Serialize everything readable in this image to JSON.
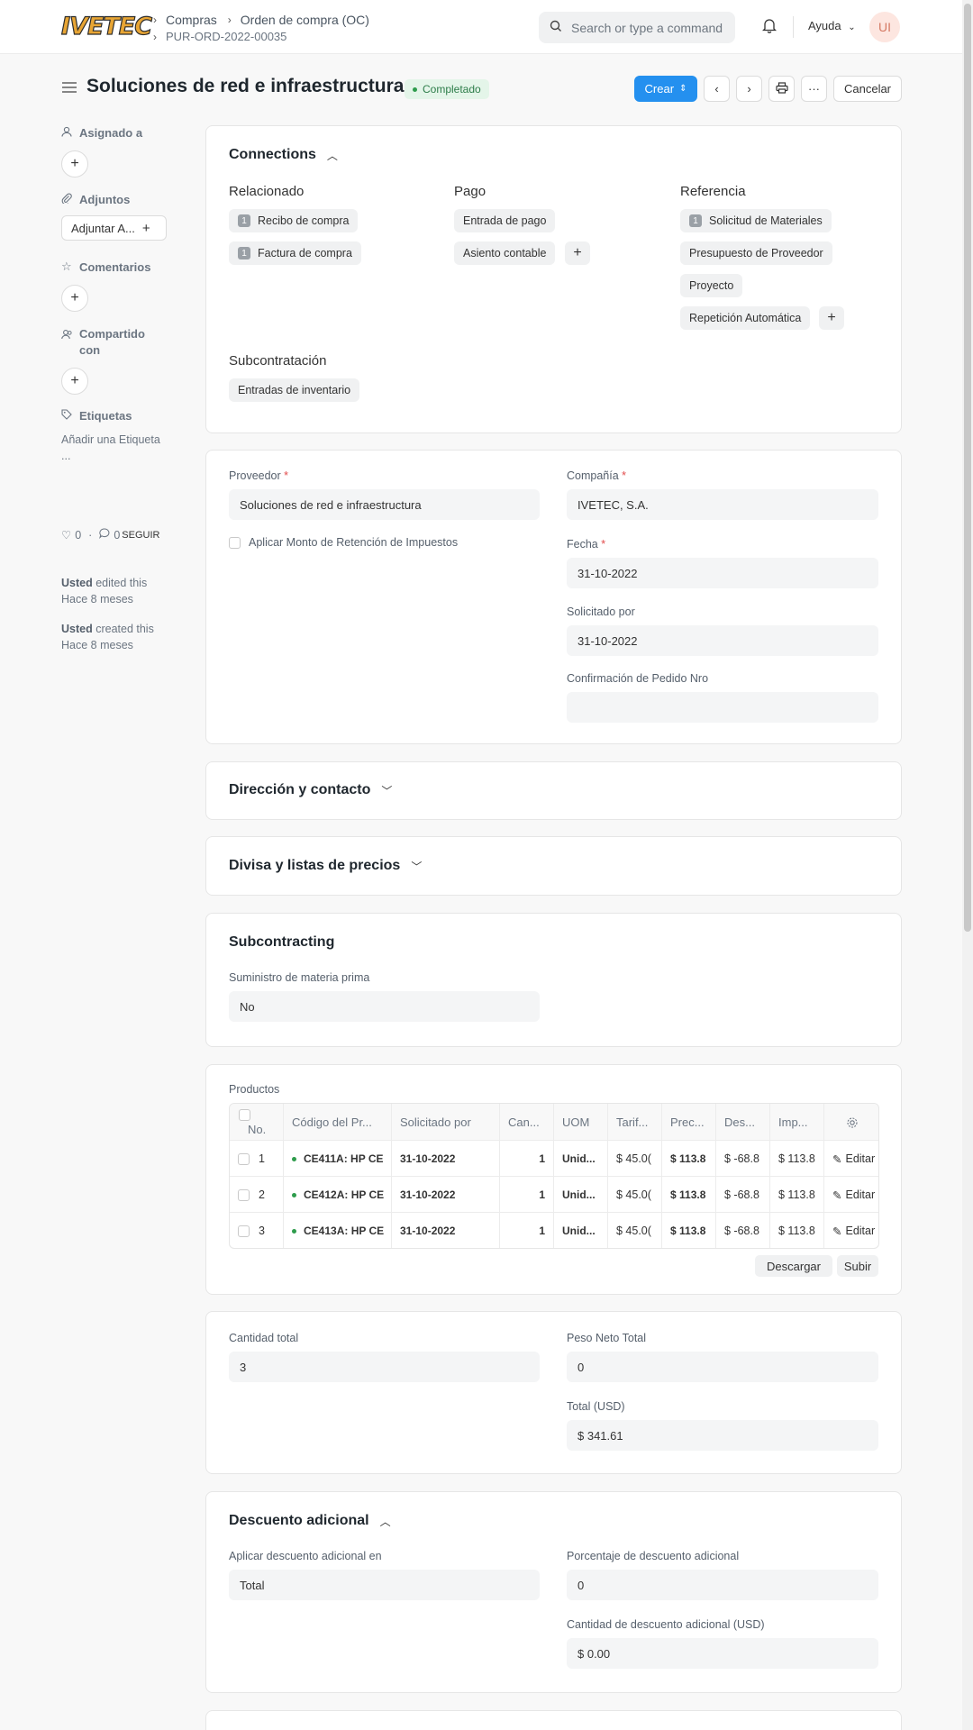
{
  "topbar": {
    "logo_text": "IVETEC",
    "breadcrumbs": [
      "Compras",
      "Orden de compra (OC)"
    ],
    "doc_id": "PUR-ORD-2022-00035",
    "search_placeholder": "Search or type a command",
    "help_label": "Ayuda",
    "avatar_initials": "UI"
  },
  "header": {
    "title": "Soluciones de red e infraestructura",
    "status": "Completado",
    "create_label": "Crear",
    "more_label": "···",
    "cancel_label": "Cancelar"
  },
  "sidebar": {
    "assigned_label": "Asignado a",
    "attachments_label": "Adjuntos",
    "attach_button": "Adjuntar A...",
    "comments_label": "Comentarios",
    "shared_label": "Compartido con",
    "tags_label": "Etiquetas",
    "add_tag": "Añadir una Etiqueta ...",
    "likes": "0",
    "comments_count": "0",
    "follow_label": "SEGUIR",
    "activity": [
      {
        "who": "Usted",
        "action": "edited this",
        "when": "Hace 8 meses"
      },
      {
        "who": "Usted",
        "action": "created this",
        "when": "Hace 8 meses"
      }
    ]
  },
  "connections": {
    "title": "Connections",
    "groups": [
      {
        "heading": "Relacionado",
        "items": [
          {
            "count": "1",
            "label": "Recibo de compra"
          },
          {
            "count": "1",
            "label": "Factura de compra"
          }
        ]
      },
      {
        "heading": "Pago",
        "items": [
          {
            "count": "",
            "label": "Entrada de pago"
          },
          {
            "count": "",
            "label": "Asiento contable"
          }
        ]
      },
      {
        "heading": "Referencia",
        "items": [
          {
            "count": "1",
            "label": "Solicitud de Materiales"
          },
          {
            "count": "",
            "label": "Presupuesto de Proveedor"
          },
          {
            "count": "",
            "label": "Proyecto"
          },
          {
            "count": "",
            "label": "Repetición Automática"
          }
        ]
      },
      {
        "heading": "Subcontratación",
        "items": [
          {
            "count": "",
            "label": "Entradas de inventario"
          }
        ]
      }
    ]
  },
  "details": {
    "supplier_label": "Proveedor",
    "supplier_value": "Soluciones de red e infraestructura",
    "withholding_label": "Aplicar Monto de Retención de Impuestos",
    "company_label": "Compañía",
    "company_value": "IVETEC, S.A.",
    "date_label": "Fecha",
    "date_value": "31-10-2022",
    "required_by_label": "Solicitado por",
    "required_by_value": "31-10-2022",
    "order_confirmation_label": "Confirmación de Pedido Nro",
    "order_confirmation_value": ""
  },
  "sections": {
    "address": "Dirección y contacto",
    "currency": "Divisa y listas de precios",
    "subcontracting": "Subcontracting"
  },
  "subcontracting": {
    "supply_label": "Suministro de materia prima",
    "supply_value": "No"
  },
  "items": {
    "label": "Productos",
    "columns": [
      "No.",
      "Código del Pr...",
      "Solicitado por",
      "Can...",
      "UOM",
      "Tarif...",
      "Prec...",
      "Des...",
      "Imp..."
    ],
    "rows": [
      {
        "no": "1",
        "code": "CE411A: HP CE",
        "date": "31-10-2022",
        "qty": "1",
        "uom": "Unid...",
        "rate": "$ 45.0(",
        "price": "$ 113.8",
        "disc": "$ -68.8",
        "amount": "$ 113.8",
        "edit": "Editar"
      },
      {
        "no": "2",
        "code": "CE412A: HP CE",
        "date": "31-10-2022",
        "qty": "1",
        "uom": "Unid...",
        "rate": "$ 45.0(",
        "price": "$ 113.8",
        "disc": "$ -68.8",
        "amount": "$ 113.8",
        "edit": "Editar"
      },
      {
        "no": "3",
        "code": "CE413A: HP CE",
        "date": "31-10-2022",
        "qty": "1",
        "uom": "Unid...",
        "rate": "$ 45.0(",
        "price": "$ 113.8",
        "disc": "$ -68.8",
        "amount": "$ 113.8",
        "edit": "Editar"
      }
    ],
    "download_label": "Descargar",
    "upload_label": "Subir"
  },
  "totals": {
    "qty_label": "Cantidad total",
    "qty_value": "3",
    "net_weight_label": "Peso Neto Total",
    "net_weight_value": "0",
    "total_label": "Total (USD)",
    "total_value": "$ 341.61"
  },
  "discount": {
    "title": "Descuento adicional",
    "apply_on_label": "Aplicar descuento adicional en",
    "apply_on_value": "Total",
    "percent_label": "Porcentaje de descuento adicional",
    "percent_value": "0",
    "amount_label": "Cantidad de descuento adicional (USD)",
    "amount_value": "$ 0.00"
  }
}
